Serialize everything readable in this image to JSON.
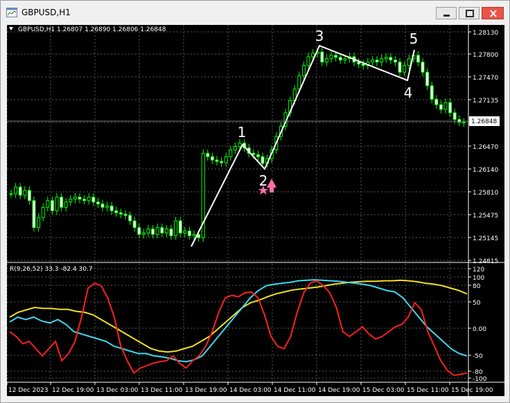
{
  "window": {
    "title": "GBPUSD,H1"
  },
  "main_chart": {
    "header": "GBPUSD,H1  1.26807 1.26890 1.26806 1.26848",
    "current_price": "1.26848",
    "price_ticks": [
      "1.28130",
      "1.27800",
      "1.27470",
      "1.27135",
      "1.26805",
      "1.26470",
      "1.26140",
      "1.25810",
      "1.25475",
      "1.25145",
      "1.24815"
    ],
    "wave_labels": [
      "1",
      "2",
      "3",
      "4",
      "5"
    ]
  },
  "indicator": {
    "header": "R(9,26,52) 33.3 -82.4 30.7",
    "ticks": [
      "120",
      "100",
      "80",
      "50",
      "0.00",
      "-50",
      "-80",
      "-100"
    ]
  },
  "time_axis": [
    "12 Dec 2023",
    "12 Dec 19:00",
    "13 Dec 03:00",
    "13 Dec 11:00",
    "13 Dec 19:00",
    "14 Dec 03:00",
    "14 Dec 11:00",
    "14 Dec 19:00",
    "15 Dec 03:00",
    "15 Dec 11:00",
    "15 Dec 19:00"
  ],
  "colors": {
    "background": "#000000",
    "candle": "#00ff00",
    "wave_line": "#ffffff",
    "red_line": "#ff2020",
    "cyan_line": "#40d8f0",
    "yellow_line": "#f0e020",
    "marker": "#ff6fa8"
  },
  "chart_data": [
    {
      "type": "candlestick",
      "title": "GBPUSD,H1",
      "ylim": [
        1.24815,
        1.283
      ],
      "close": [
        1.258,
        1.259,
        1.2578,
        1.2585,
        1.257,
        1.253,
        1.2545,
        1.256,
        1.257,
        1.2555,
        1.2575,
        1.256,
        1.2568,
        1.2572,
        1.2575,
        1.2572,
        1.257,
        1.2575,
        1.2568,
        1.2565,
        1.256,
        1.2562,
        1.2555,
        1.2552,
        1.255,
        1.2548,
        1.254,
        1.253,
        1.252,
        1.2522,
        1.2528,
        1.252,
        1.253,
        1.2522,
        1.2528,
        1.2518,
        1.254,
        1.2522,
        1.2525,
        1.2518,
        1.252,
        1.2515,
        1.264,
        1.2635,
        1.263,
        1.2628,
        1.2626,
        1.2635,
        1.2645,
        1.265,
        1.2655,
        1.2648,
        1.264,
        1.2638,
        1.2635,
        1.2625,
        1.2632,
        1.2645,
        1.2665,
        1.268,
        1.27,
        1.2718,
        1.2735,
        1.2755,
        1.277,
        1.2783,
        1.2788,
        1.279,
        1.2775,
        1.278,
        1.2785,
        1.2782,
        1.2778,
        1.278,
        1.2783,
        1.2775,
        1.2772,
        1.277,
        1.2775,
        1.2778,
        1.2775,
        1.278,
        1.2782,
        1.2778,
        1.2775,
        1.276,
        1.277,
        1.278,
        1.2785,
        1.2775,
        1.276,
        1.274,
        1.272,
        1.2712,
        1.2705,
        1.2715,
        1.27,
        1.269,
        1.2686,
        1.2685
      ]
    },
    {
      "type": "line",
      "title": "R(9,26,52)",
      "ylim": [
        -110,
        120
      ],
      "series": [
        {
          "values": [
            -10,
            -20,
            -35,
            -30,
            -45,
            -60,
            -45,
            -30,
            -70,
            -55,
            -30,
            20,
            80,
            90,
            85,
            60,
            20,
            -40,
            -70,
            -95,
            -85,
            -80,
            -75,
            -72,
            -70,
            -60,
            -75,
            -85,
            -70,
            -60,
            -40,
            -10,
            30,
            60,
            65,
            62,
            70,
            72,
            60,
            25,
            -20,
            -40,
            -45,
            -20,
            30,
            70,
            90,
            95,
            85,
            70,
            40,
            -10,
            -20,
            -10,
            0,
            -15,
            -25,
            -20,
            -10,
            0,
            5,
            20,
            50,
            35,
            -10,
            -40,
            -70,
            -90,
            -100,
            -98,
            -95
          ]
        },
        {
          "values": [
            10,
            20,
            15,
            20,
            12,
            8,
            15,
            5,
            -10,
            -15,
            -20,
            -25,
            -30,
            -40,
            -45,
            -50,
            -55,
            -55,
            -60,
            -62,
            -65,
            -70,
            -72,
            -68,
            -60,
            -40,
            -20,
            0,
            20,
            40,
            60,
            75,
            85,
            88,
            90,
            92,
            95,
            96,
            97,
            96,
            95,
            94,
            92,
            90,
            88,
            85,
            80,
            75,
            72,
            60,
            40,
            20,
            0,
            -15,
            -30,
            -45,
            -55,
            -60
          ]
        },
        {
          "values": [
            20,
            30,
            35,
            40,
            38,
            38,
            36,
            36,
            32,
            30,
            25,
            15,
            5,
            -5,
            -15,
            -25,
            -35,
            -45,
            -50,
            -52,
            -50,
            -45,
            -40,
            -30,
            -20,
            -5,
            10,
            25,
            40,
            50,
            55,
            62,
            68,
            72,
            76,
            78,
            80,
            82,
            85,
            88,
            90,
            92,
            93,
            94,
            94,
            95,
            95,
            96,
            95,
            93,
            90,
            88,
            85,
            80,
            75,
            68
          ]
        }
      ]
    }
  ]
}
